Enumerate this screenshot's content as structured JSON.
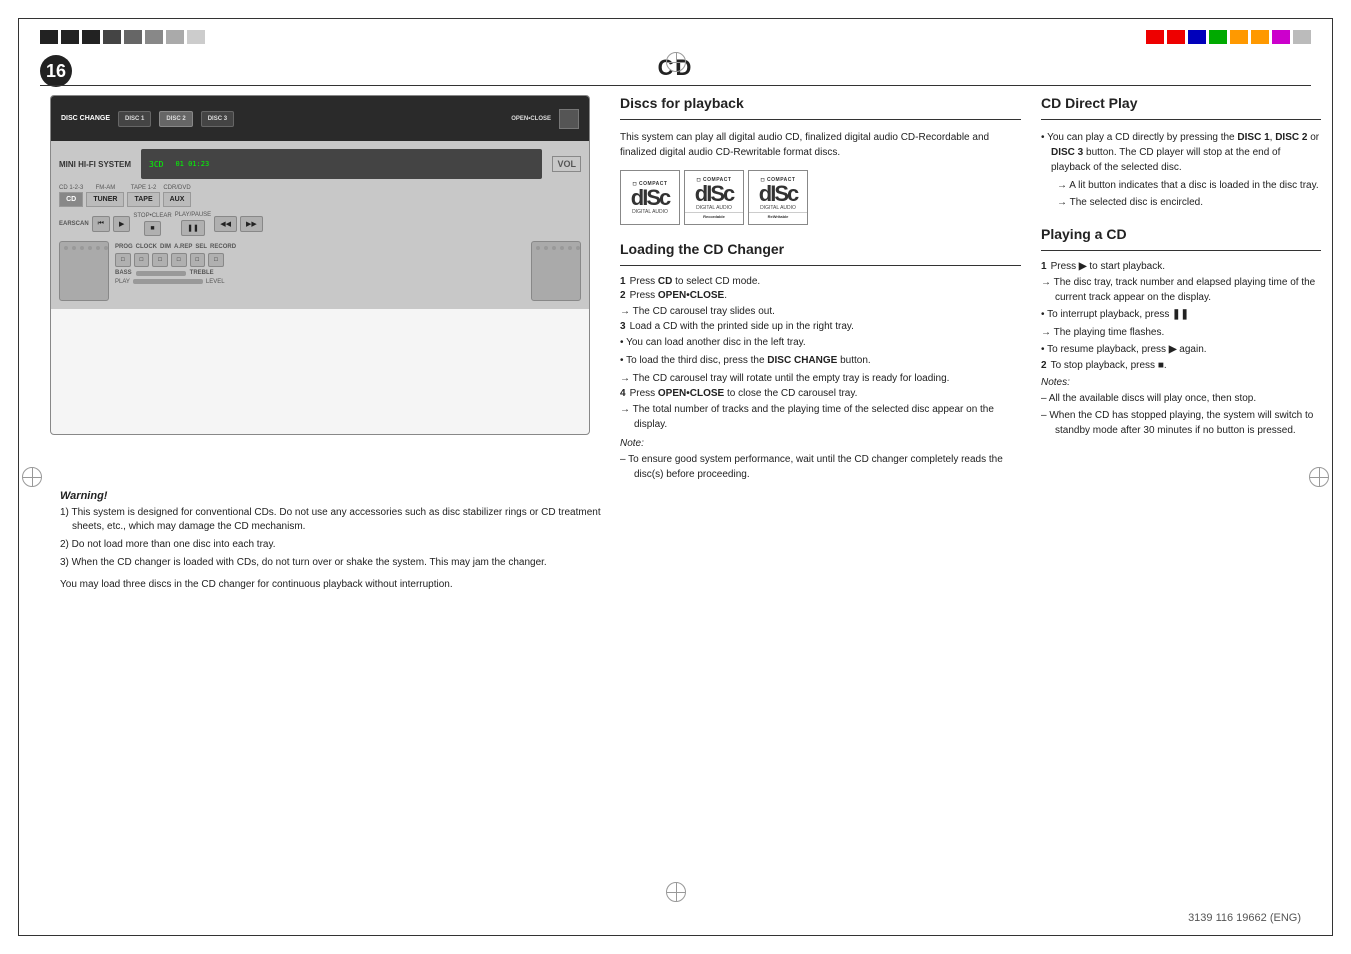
{
  "page": {
    "number": "16",
    "title": "CD",
    "document_id": "3139 116 19662 (ENG)"
  },
  "top_strip_left": {
    "colors": [
      "#222",
      "#222",
      "#222",
      "#aaa",
      "#aaa",
      "#ccc",
      "#ccc",
      "#ddd"
    ]
  },
  "top_strip_right": {
    "colors": [
      "#e00",
      "#e00",
      "#00a",
      "#0a0",
      "#f80",
      "#f80",
      "#c0c",
      "#aaa"
    ]
  },
  "device": {
    "disc_change_label": "DISC CHANGE",
    "open_close_label": "OPEN•CLOSE",
    "disc_buttons": [
      "DISC 1",
      "DISC 2",
      "DISC 3"
    ],
    "model_label": "3CD",
    "display_text": "3CD"
  },
  "warning": {
    "title": "Warning!",
    "items": [
      "1) This system is designed for conventional CDs. Do not use any accessories such as disc stabilizer rings or CD treatment sheets, etc., which may damage the CD mechanism.",
      "2) Do not load more than one disc into each tray.",
      "3) When the CD changer is loaded with CDs, do not turn over or shake the system. This may jam the changer."
    ],
    "you_may_load": "You may load three discs in the CD changer for continuous playback without interruption."
  },
  "discs_for_playback": {
    "heading": "Discs for playback",
    "body": "This system can play all digital audio CD, finalized digital audio CD-Recordable and finalized digital audio CD-Rewritable format discs.",
    "disc_types": [
      {
        "top": "COMPACT",
        "middle": "disc",
        "sub": "DIGITAL AUDIO",
        "bottom": ""
      },
      {
        "top": "COMPACT",
        "middle": "disc",
        "sub": "DIGITAL AUDIO",
        "bottom": "Recordable"
      },
      {
        "top": "COMPACT",
        "middle": "disc",
        "sub": "DIGITAL AUDIO",
        "bottom": "ReWritable"
      }
    ]
  },
  "loading_cd_changer": {
    "heading": "Loading the CD Changer",
    "steps": [
      {
        "num": "1",
        "text": "Press ",
        "bold": "CD",
        "rest": " to select CD mode."
      },
      {
        "num": "2",
        "text": "Press ",
        "bold": "OPEN•CLOSE",
        "rest": "."
      },
      {
        "num": "2a",
        "arrow": "The CD carousel tray slides out."
      },
      {
        "num": "3",
        "text": "Load a CD with the printed side up in the right tray."
      },
      {
        "num": "b1",
        "text": "You can load another disc in the left tray."
      },
      {
        "num": "b2",
        "text": "To load the third disc, press the ",
        "bold": "DISC CHANGE",
        "rest": " button."
      },
      {
        "num": "3a",
        "arrow": "The CD carousel tray will rotate until the empty tray is ready for loading."
      },
      {
        "num": "4",
        "text": "Press ",
        "bold": "OPEN•CLOSE",
        "rest": " to close the CD carousel tray."
      },
      {
        "num": "4a",
        "arrow": "The total number of tracks and the playing time of the selected disc appear on the display."
      }
    ],
    "note_label": "Note:",
    "note": "– To ensure good system performance, wait until the CD changer completely reads the disc(s) before proceeding."
  },
  "cd_direct_play": {
    "heading": "CD Direct Play",
    "bullets": [
      "You can play a CD directly by pressing the DISC 1, DISC 2 or DISC 3 button. The CD player will stop at the end of playback of the selected disc.",
      "A lit button indicates that a disc is loaded in the disc tray.",
      "The selected disc is encircled."
    ]
  },
  "playing_a_cd": {
    "heading": "Playing a CD",
    "steps": [
      {
        "num": "1",
        "text": "Press ▶ to start playback."
      },
      {
        "num": "1a",
        "arrow": "The disc tray, track number and elapsed playing time of the current track appear on the display."
      },
      {
        "num": "b1",
        "text": "To interrupt playback, press ❚❚"
      },
      {
        "num": "b1a",
        "arrow": "The playing time flashes."
      },
      {
        "num": "b2",
        "text": "To resume playback, press ▶ again."
      },
      {
        "num": "2",
        "text": "To stop playback, press ■."
      }
    ],
    "notes_label": "Notes:",
    "notes": [
      "– All the available discs will play once, then stop.",
      "– When the CD has stopped playing, the system will switch to standby mode after 30 minutes if no button is pressed."
    ]
  }
}
